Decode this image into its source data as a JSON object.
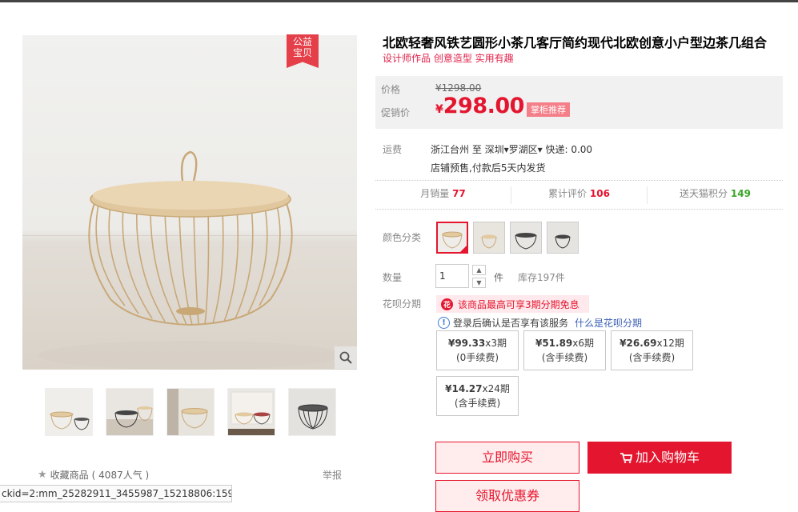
{
  "badge": {
    "line1": "公益",
    "line2": "宝贝"
  },
  "icons": {
    "zoom": "magnifier-icon",
    "star": "star-icon",
    "cart": "cart-icon",
    "huabei": "huabei-logo-icon",
    "info": "info-icon"
  },
  "product": {
    "title": "北欧轻奢风铁艺圆形小茶几客厅简约现代北欧创意小户型边茶几组合",
    "subtitle": "设计师作品 创意造型 实用有趣"
  },
  "price": {
    "orig_label": "价格",
    "orig_value": "¥1298.00",
    "sale_label": "促销价",
    "currency": "¥",
    "sale_value": "298.00",
    "promo_tag": "掌柜推荐"
  },
  "shipping": {
    "label": "运费",
    "line1": "浙江台州  至 深圳▾罗湖区▾ 快递: 0.00",
    "line2": "店铺预售,付款后5天内发货"
  },
  "stats": [
    {
      "label": "月销量",
      "value": "77"
    },
    {
      "label": "累计评价",
      "value": "106"
    },
    {
      "label": "送天猫积分",
      "value": "149"
    }
  ],
  "color": {
    "label": "颜色分类"
  },
  "quantity": {
    "label": "数量",
    "value": "1",
    "unit": "件",
    "stock": "库存197件",
    "up": "▲",
    "down": "▼"
  },
  "huabei": {
    "label": "花呗分期",
    "banner": "该商品最高可享3期分期免息",
    "info": "登录后确认是否享有该服务",
    "link": "什么是花呗分期",
    "plans": [
      {
        "amount": "¥99.33",
        "term": "x3期",
        "fee": "(0手续费)"
      },
      {
        "amount": "¥51.89",
        "term": "x6期",
        "fee": "(含手续费)"
      },
      {
        "amount": "¥26.69",
        "term": "x12期",
        "fee": "(含手续费)"
      },
      {
        "amount": "¥14.27",
        "term": "x24期",
        "fee": "(含手续费)"
      }
    ]
  },
  "actions": {
    "buy": "立即购买",
    "cart": "加入购物车",
    "coupon": "领取优惠券"
  },
  "favorite": {
    "label": "收藏商品",
    "count": "( 4087人气 )"
  },
  "report": "举报",
  "status_url": "ckid=2:mm_25282911_3455987_15218806:159..."
}
